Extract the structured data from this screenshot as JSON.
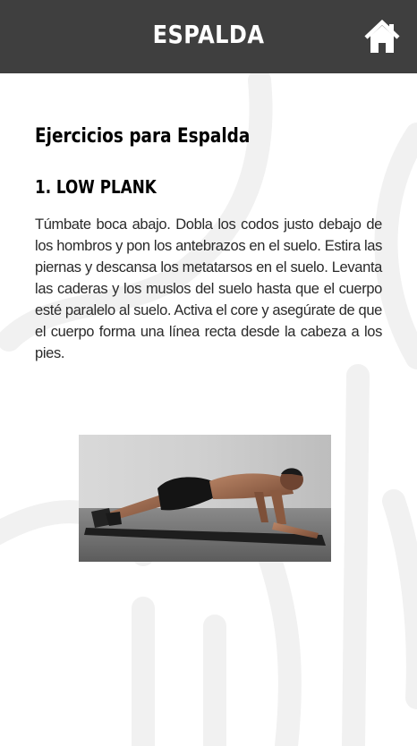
{
  "header": {
    "title": "ESPALDA",
    "home_icon": "home-icon"
  },
  "main": {
    "section_title": "Ejercicios para Espalda",
    "exercise": {
      "title": "1. LOW PLANK",
      "description": "Túmbate boca abajo. Dobla los codos justo debajo de los hombros y pon los antebrazos en el suelo. Estira las piernas y descansa los metatarsos en el suelo. Levanta las caderas y los muslos del suelo hasta que el cuerpo esté paralelo al suelo. Activa el core y asegúrate de que el cuerpo forma una línea recta desde la cabeza a los pies.",
      "image": "man-doing-low-plank-photo"
    }
  },
  "colors": {
    "header_bg": "#3f3f3f",
    "header_text": "#ffffff",
    "body_text": "#2a2a2a"
  }
}
